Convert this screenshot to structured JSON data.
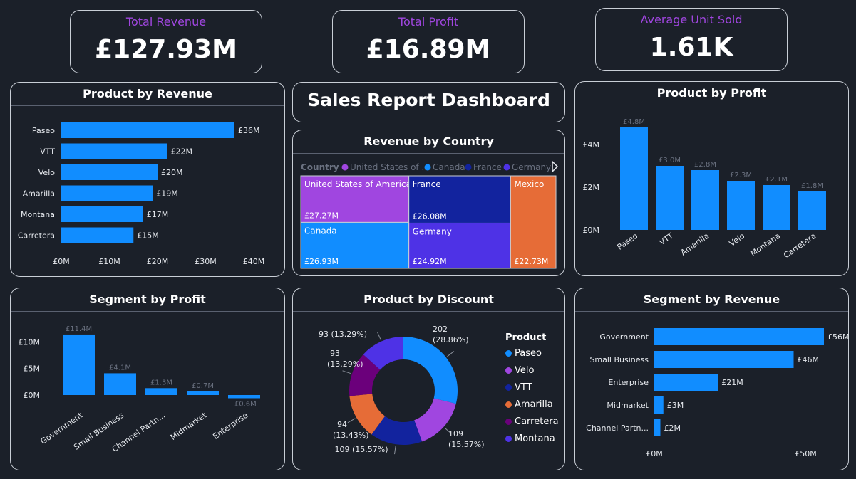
{
  "kpis": {
    "revenue": {
      "title": "Total Revenue",
      "value": "£127.93M"
    },
    "profit": {
      "title": "Total Profit",
      "value": "£16.89M"
    },
    "units": {
      "title": "Average Unit Sold",
      "value": "1.61K"
    }
  },
  "dashboard_title": "Sales Report Dashboard",
  "colors": {
    "accent_blue": "#118dff",
    "purple": "#a046e0",
    "navy": "#12239e",
    "orange": "#e66c37",
    "violet": "#6b007b",
    "indigo": "#4e32e6",
    "bg": "#1b2029",
    "border": "#c9ced6"
  },
  "chart_data": [
    {
      "id": "product_revenue",
      "type": "bar",
      "orientation": "horizontal",
      "title": "Product by Revenue",
      "categories": [
        "Paseo",
        "VTT",
        "Velo",
        "Amarilla",
        "Montana",
        "Carretera"
      ],
      "values": [
        36,
        22,
        20,
        19,
        17,
        15
      ],
      "data_labels": [
        "£36M",
        "£22M",
        "£20M",
        "£19M",
        "£17M",
        "£15M"
      ],
      "x_ticks": [
        "£0M",
        "£10M",
        "£20M",
        "£30M",
        "£40M"
      ],
      "xlim": [
        0,
        40
      ]
    },
    {
      "id": "product_profit",
      "type": "bar",
      "title": "Product by Profit",
      "categories": [
        "Paseo",
        "VTT",
        "Amarilla",
        "Velo",
        "Montana",
        "Carretera"
      ],
      "values": [
        4.8,
        3.0,
        2.8,
        2.3,
        2.1,
        1.8
      ],
      "data_labels": [
        "£4.8M",
        "£3.0M",
        "£2.8M",
        "£2.3M",
        "£2.1M",
        "£1.8M"
      ],
      "y_ticks": [
        "£0M",
        "£2M",
        "£4M"
      ],
      "ylim": [
        0,
        5
      ]
    },
    {
      "id": "segment_profit",
      "type": "bar",
      "title": "Segment by Profit",
      "categories": [
        "Government",
        "Small Business",
        "Channel Partn...",
        "Midmarket",
        "Enterprise"
      ],
      "values": [
        11.4,
        4.1,
        1.3,
        0.7,
        -0.6
      ],
      "data_labels": [
        "£11.4M",
        "£4.1M",
        "£1.3M",
        "£0.7M",
        "-£0.6M"
      ],
      "y_ticks": [
        "£0M",
        "£5M",
        "£10M"
      ],
      "ylim": [
        -0.6,
        12
      ]
    },
    {
      "id": "segment_revenue",
      "type": "bar",
      "orientation": "horizontal",
      "title": "Segment by Revenue",
      "categories": [
        "Government",
        "Small Business",
        "Enterprise",
        "Midmarket",
        "Channel Partn..."
      ],
      "values": [
        56,
        46,
        21,
        3,
        2
      ],
      "data_labels": [
        "£56M",
        "£46M",
        "£21M",
        "£3M",
        "£2M"
      ],
      "x_ticks": [
        "£0M",
        "£50M"
      ],
      "xlim": [
        0,
        60
      ]
    },
    {
      "id": "revenue_country",
      "type": "treemap",
      "title": "Revenue by Country",
      "legend_title": "Country",
      "legend": [
        "United States of ...",
        "Canada",
        "France",
        "Germany"
      ],
      "items": [
        {
          "name": "United States of America",
          "label": "£27.27M",
          "value": 27.27,
          "color": "#a046e0"
        },
        {
          "name": "France",
          "label": "£26.08M",
          "value": 26.08,
          "color": "#12239e"
        },
        {
          "name": "Mexico",
          "label": "£22.73M",
          "value": 22.73,
          "color": "#e66c37"
        },
        {
          "name": "Canada",
          "label": "£26.93M",
          "value": 26.93,
          "color": "#118dff"
        },
        {
          "name": "Germany",
          "label": "£24.92M",
          "value": 24.92,
          "color": "#4e32e6"
        }
      ]
    },
    {
      "id": "product_discount",
      "type": "pie",
      "style": "donut",
      "title": "Product by Discount",
      "legend_title": "Product",
      "slices": [
        {
          "name": "Paseo",
          "value": 202,
          "label1": "202",
          "label2": "(28.86%)",
          "color": "#118dff"
        },
        {
          "name": "Velo",
          "value": 109,
          "label1": "109",
          "label2": "(15.57%)",
          "color": "#a046e0"
        },
        {
          "name": "VTT",
          "value": 109,
          "label1": "109 (15.57%)",
          "label2": "",
          "color": "#12239e"
        },
        {
          "name": "Amarilla",
          "value": 94,
          "label1": "94",
          "label2": "(13.43%)",
          "color": "#e66c37"
        },
        {
          "name": "Carretera",
          "value": 93,
          "label1": "93",
          "label2": "(13.29%)",
          "color": "#6b007b"
        },
        {
          "name": "Montana",
          "value": 93,
          "label1": "93 (13.29%)",
          "label2": "",
          "color": "#4e32e6"
        }
      ]
    }
  ]
}
